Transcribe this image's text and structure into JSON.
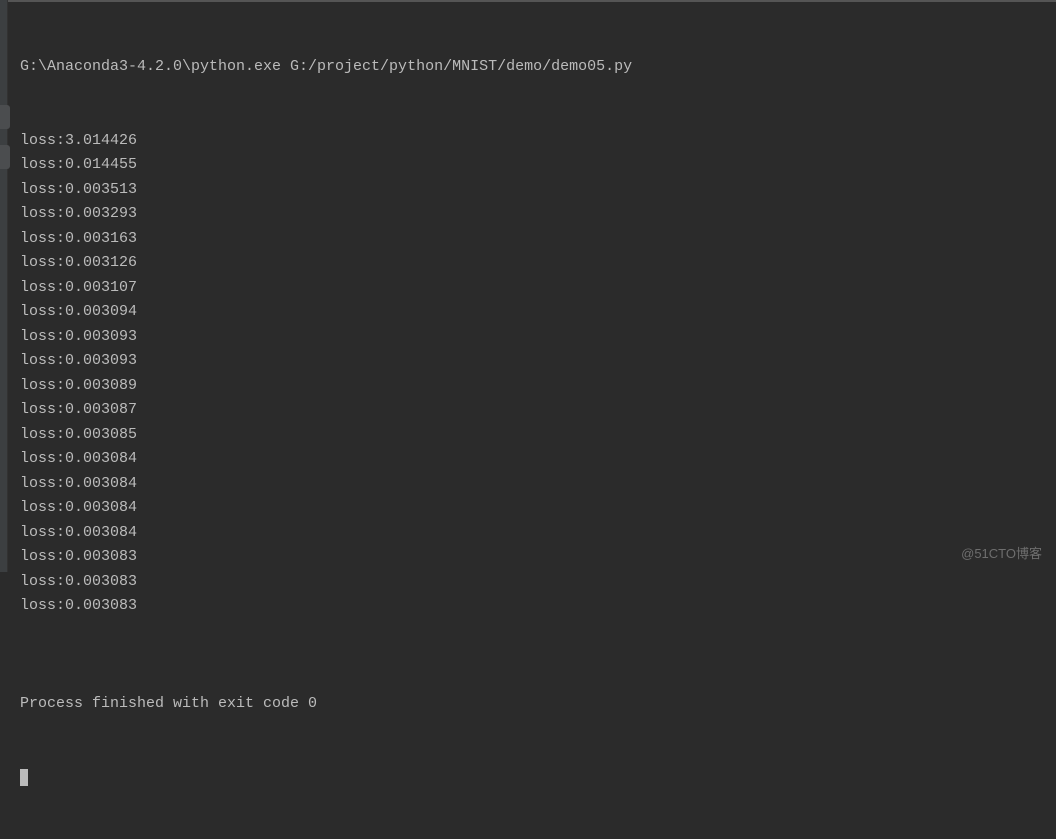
{
  "command": "G:\\Anaconda3-4.2.0\\python.exe G:/project/python/MNIST/demo/demo05.py",
  "loss_prefix": "loss:",
  "loss_values": [
    "3.014426",
    "0.014455",
    "0.003513",
    "0.003293",
    "0.003163",
    "0.003126",
    "0.003107",
    "0.003094",
    "0.003093",
    "0.003093",
    "0.003089",
    "0.003087",
    "0.003085",
    "0.003084",
    "0.003084",
    "0.003084",
    "0.003084",
    "0.003083",
    "0.003083",
    "0.003083"
  ],
  "process_message": "Process finished with exit code 0",
  "watermark": "@51CTO博客"
}
